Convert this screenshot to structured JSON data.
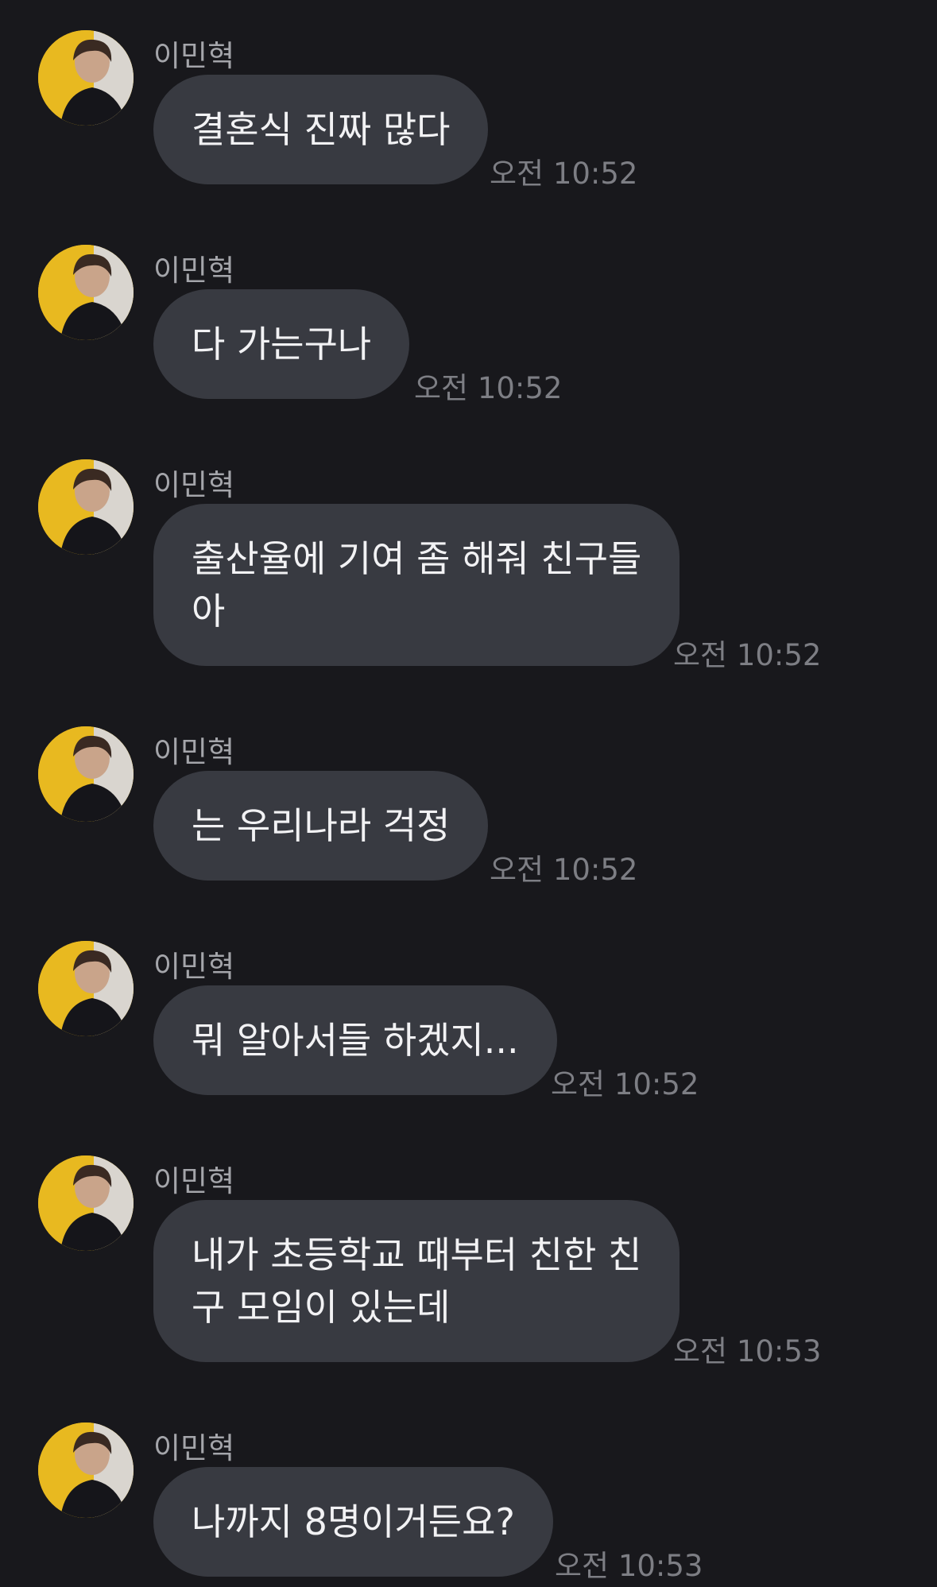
{
  "chat": {
    "messages": [
      {
        "sender": "이민혁",
        "text": "결혼식 진짜 많다",
        "time": "오전 10:52"
      },
      {
        "sender": "이민혁",
        "text": "다 가는구나",
        "time": "오전 10:52"
      },
      {
        "sender": "이민혁",
        "line1": "출산율에 기여 좀 해줘 친구들",
        "line2": "아",
        "time": "오전 10:52"
      },
      {
        "sender": "이민혁",
        "text": "는 우리나라 걱정",
        "time": "오전 10:52"
      },
      {
        "sender": "이민혁",
        "text": "뭐 알아서들 하겠지...",
        "time": "오전 10:52"
      },
      {
        "sender": "이민혁",
        "line1": "내가 초등학교 때부터 친한 친",
        "line2": "구 모임이 있는데",
        "time": "오전 10:53"
      },
      {
        "sender": "이민혁",
        "text": "나까지 8명이거든요?",
        "time": "오전 10:53"
      }
    ]
  },
  "colors": {
    "background": "#18181c",
    "bubble": "#383a41",
    "message_text": "#f2f2f4",
    "sender_text": "#a4a5aa",
    "time_text": "#7d7e84",
    "avatar_accent": "#e8b920"
  }
}
